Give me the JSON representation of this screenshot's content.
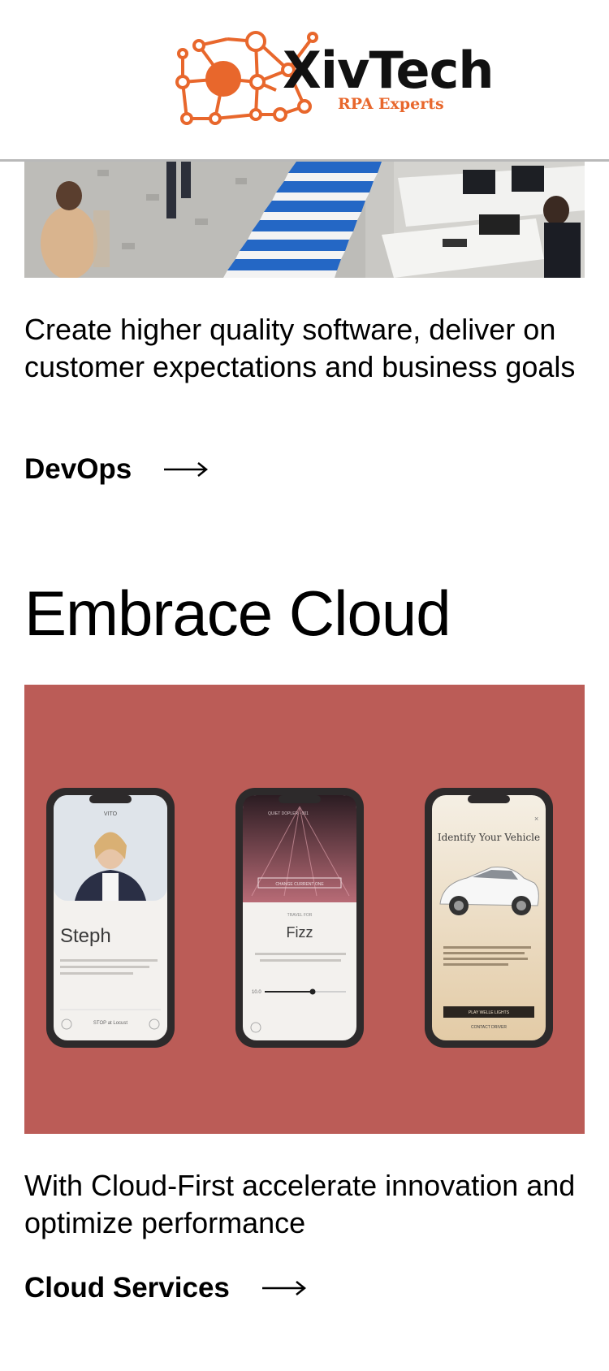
{
  "header": {
    "brand_name": "XivTech",
    "brand_tagline": "RPA Experts",
    "accent_color": "#e8672c"
  },
  "section_devops": {
    "description": "Create higher quality software, deliver on customer expectations and business goals",
    "link_label": "DevOps",
    "link_icon": "arrow-right-icon"
  },
  "section_cloud": {
    "heading": "Embrace Cloud",
    "hero_bg": "#bb5c57",
    "phones": [
      {
        "header_text": "VITO",
        "title": "Steph",
        "footer_text": "STOP at Locust"
      },
      {
        "header_text": "QUIET DOPLER · 001",
        "button_text": "CHANGE CURRENT ONE",
        "subtitle": "TRAVEL FOR",
        "title": "Fizz",
        "value": "10.0"
      },
      {
        "title": "Identify Your Vehicle",
        "button_text": "PLAY WELLE LIGHTS",
        "secondary_text": "CONTACT DRIVER"
      }
    ],
    "description": "With Cloud-First accelerate innovation and optimize performance",
    "link_label": "Cloud Services",
    "link_icon": "arrow-right-icon"
  }
}
